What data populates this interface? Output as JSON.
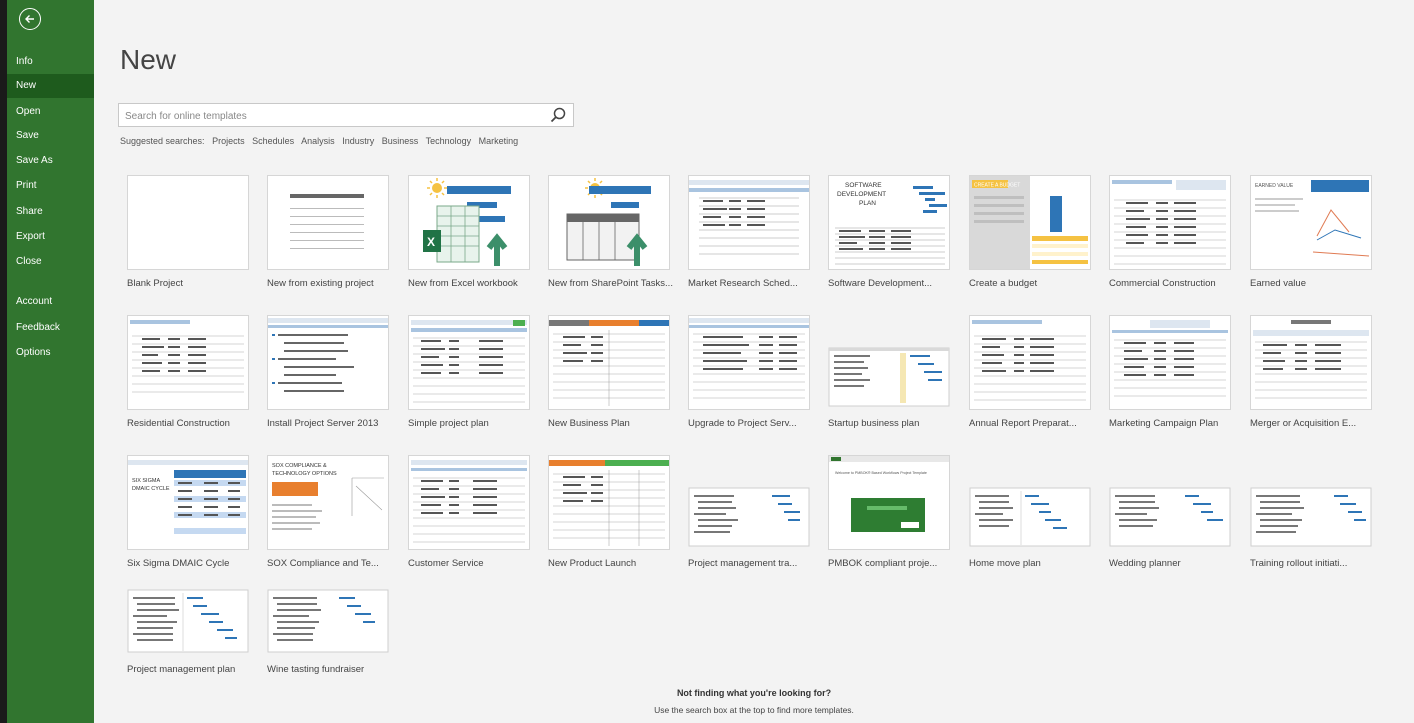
{
  "sidebar": {
    "back_icon": "back-arrow-icon",
    "items": [
      {
        "label": "Info"
      },
      {
        "label": "New",
        "active": true
      },
      {
        "label": "Open"
      },
      {
        "label": "Save"
      },
      {
        "label": "Save As"
      },
      {
        "label": "Print"
      },
      {
        "label": "Share"
      },
      {
        "label": "Export"
      },
      {
        "label": "Close"
      },
      {
        "label": "Account"
      },
      {
        "label": "Feedback"
      },
      {
        "label": "Options"
      }
    ]
  },
  "main": {
    "title": "New",
    "search": {
      "placeholder": "Search for online templates",
      "icon": "search-icon"
    },
    "suggested": {
      "label": "Suggested searches:",
      "links": [
        "Projects",
        "Schedules",
        "Analysis",
        "Industry",
        "Business",
        "Technology",
        "Marketing"
      ]
    },
    "templates": [
      {
        "label": "Blank Project"
      },
      {
        "label": "New from existing project"
      },
      {
        "label": "New from Excel workbook"
      },
      {
        "label": "New from SharePoint Tasks..."
      },
      {
        "label": "Market Research Sched..."
      },
      {
        "label": "Software Development..."
      },
      {
        "label": "Create a budget"
      },
      {
        "label": "Commercial Construction"
      },
      {
        "label": "Earned value"
      },
      {
        "label": "Residential Construction"
      },
      {
        "label": "Install Project Server 2013"
      },
      {
        "label": "Simple project plan"
      },
      {
        "label": "New Business Plan"
      },
      {
        "label": "Upgrade to Project Serv..."
      },
      {
        "label": "Startup business plan"
      },
      {
        "label": "Annual Report Preparat..."
      },
      {
        "label": "Marketing Campaign Plan"
      },
      {
        "label": "Merger or Acquisition E..."
      },
      {
        "label": "Six Sigma DMAIC Cycle"
      },
      {
        "label": "SOX Compliance and Te..."
      },
      {
        "label": "Customer Service"
      },
      {
        "label": "New Product Launch"
      },
      {
        "label": "Project management tra..."
      },
      {
        "label": "PMBOK compliant proje..."
      },
      {
        "label": "Home move plan"
      },
      {
        "label": "Wedding planner"
      },
      {
        "label": "Training rollout initiati..."
      },
      {
        "label": "Project management plan"
      },
      {
        "label": "Wine tasting fundraiser"
      }
    ],
    "thumb_text": {
      "software": [
        "SOFTWARE",
        "DEVELOPMENT",
        "PLAN"
      ],
      "budget": "CREATE A BUDGET",
      "earned": "EARNED VALUE",
      "sixsigma": [
        "SIX SIGMA",
        "DMAIC CYCLE"
      ],
      "sox": [
        "SOX COMPLIANCE &",
        "TECHNOLOGY OPTIONS"
      ],
      "pmbok": "Welcome to PMBOK® Based Workflows Project Template"
    },
    "footer": {
      "bold": "Not finding what you're looking for?",
      "sub": "Use the search box at the top to find more templates."
    }
  },
  "colors": {
    "accent": "#31752f",
    "accent_dark": "#1e5b1d",
    "background": "#f3f3f3",
    "gantt_blue": "#2e75b6",
    "excel_green": "#217346"
  }
}
